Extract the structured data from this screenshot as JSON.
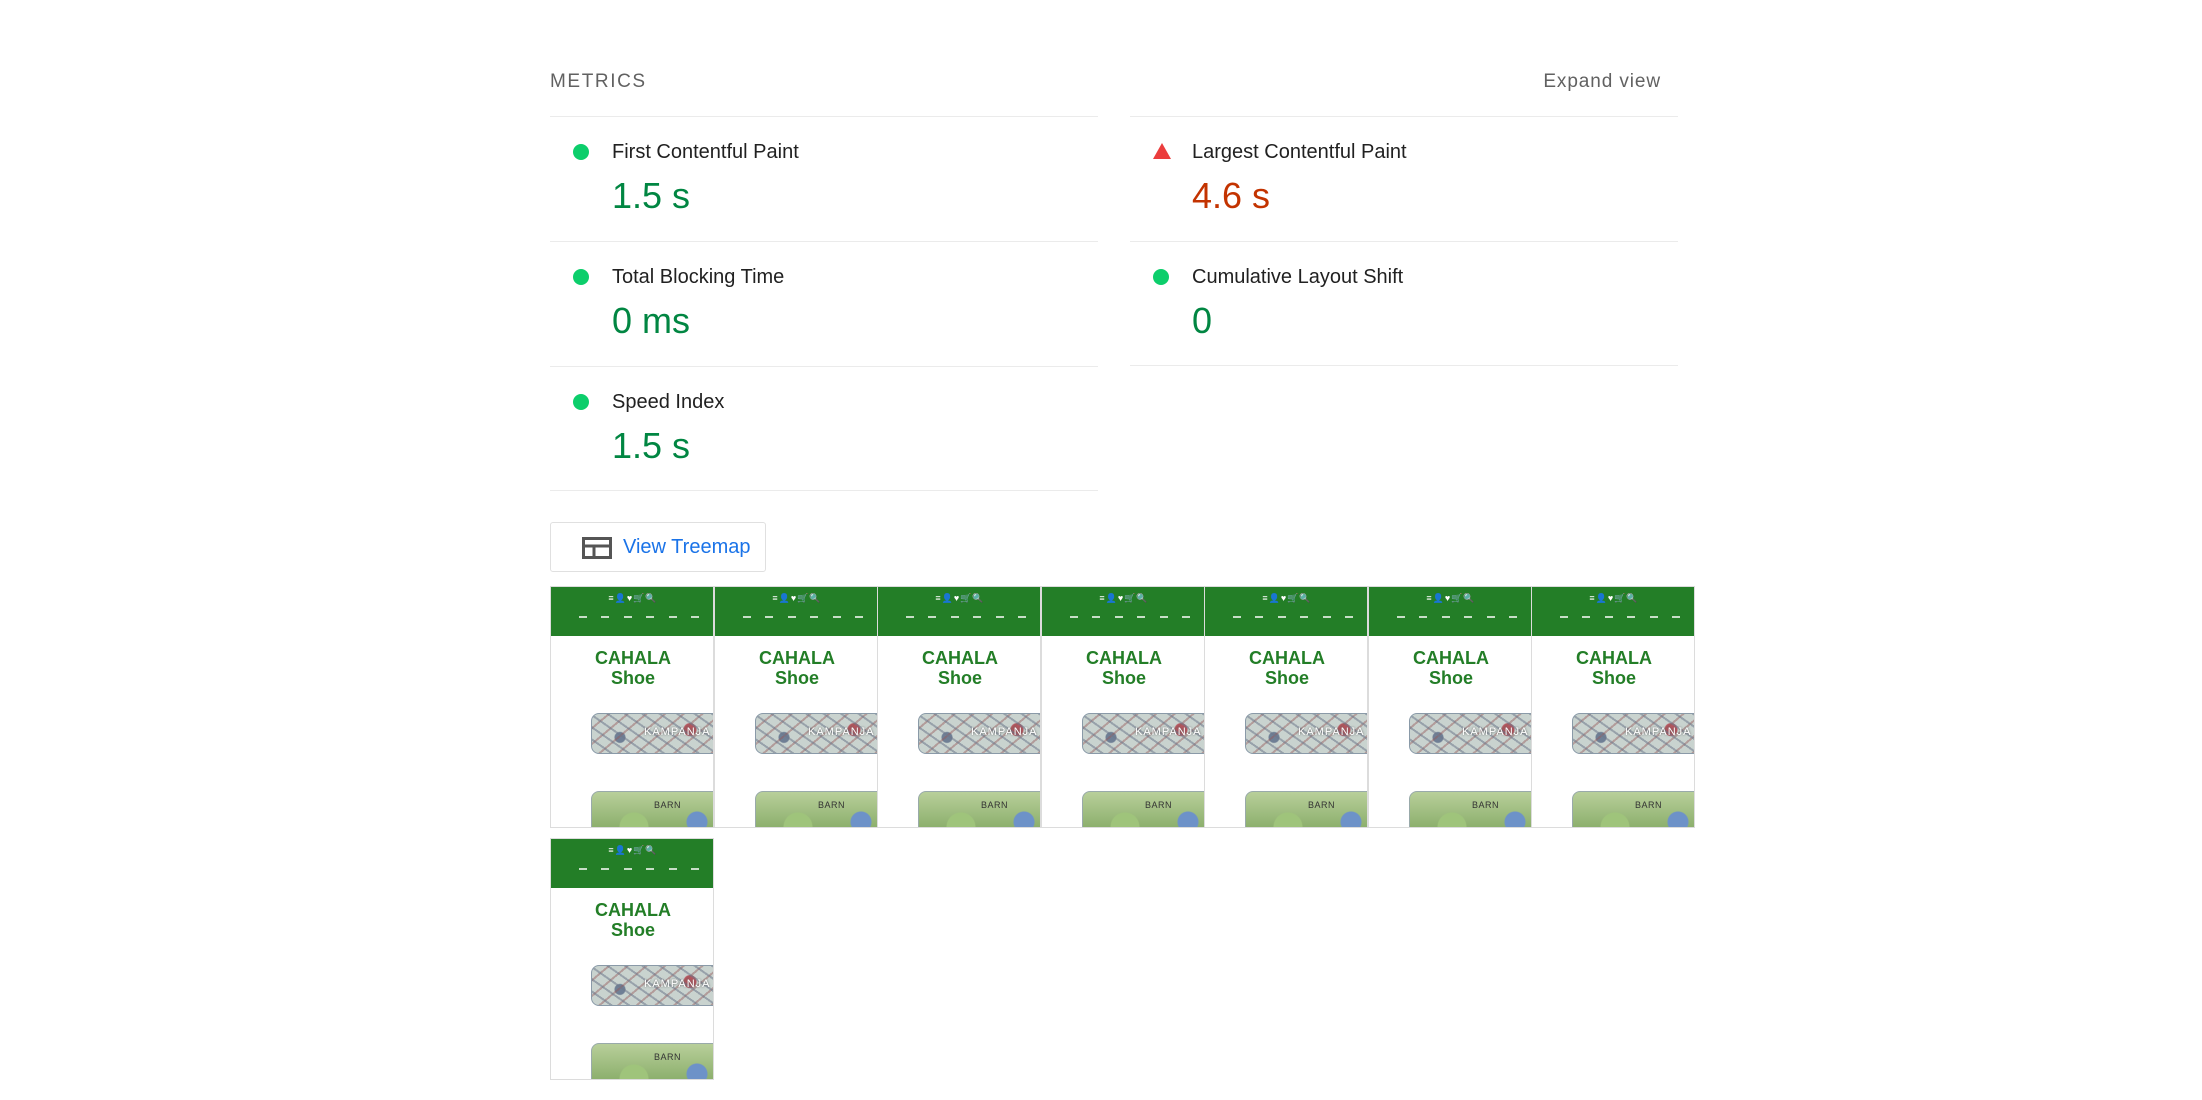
{
  "header": {
    "title": "METRICS",
    "expand_label": "Expand view"
  },
  "metrics": [
    {
      "label": "First Contentful Paint",
      "value": "1.5 s",
      "status": "pass"
    },
    {
      "label": "Largest Contentful Paint",
      "value": "4.6 s",
      "status": "fail"
    },
    {
      "label": "Total Blocking Time",
      "value": "0 ms",
      "status": "pass"
    },
    {
      "label": "Cumulative Layout Shift",
      "value": "0",
      "status": "pass"
    },
    {
      "label": "Speed Index",
      "value": "1.5 s",
      "status": "pass"
    }
  ],
  "treemap": {
    "label": "View Treemap",
    "icon": "treemap-icon"
  },
  "filmstrip": {
    "frame_count": 8,
    "frame": {
      "title_line1": "CAHALA",
      "title_line2": "Shoe",
      "header_icons": "≡👤♥🛒🔍",
      "banner1_text": "KAMPANJA",
      "banner2_text": "BARN"
    }
  },
  "colors": {
    "pass": "#0cce6b",
    "pass_text": "#018642",
    "fail": "#eb3d3d",
    "fail_text": "#c33300",
    "link": "#1a73e8",
    "site_green": "#237e27"
  }
}
